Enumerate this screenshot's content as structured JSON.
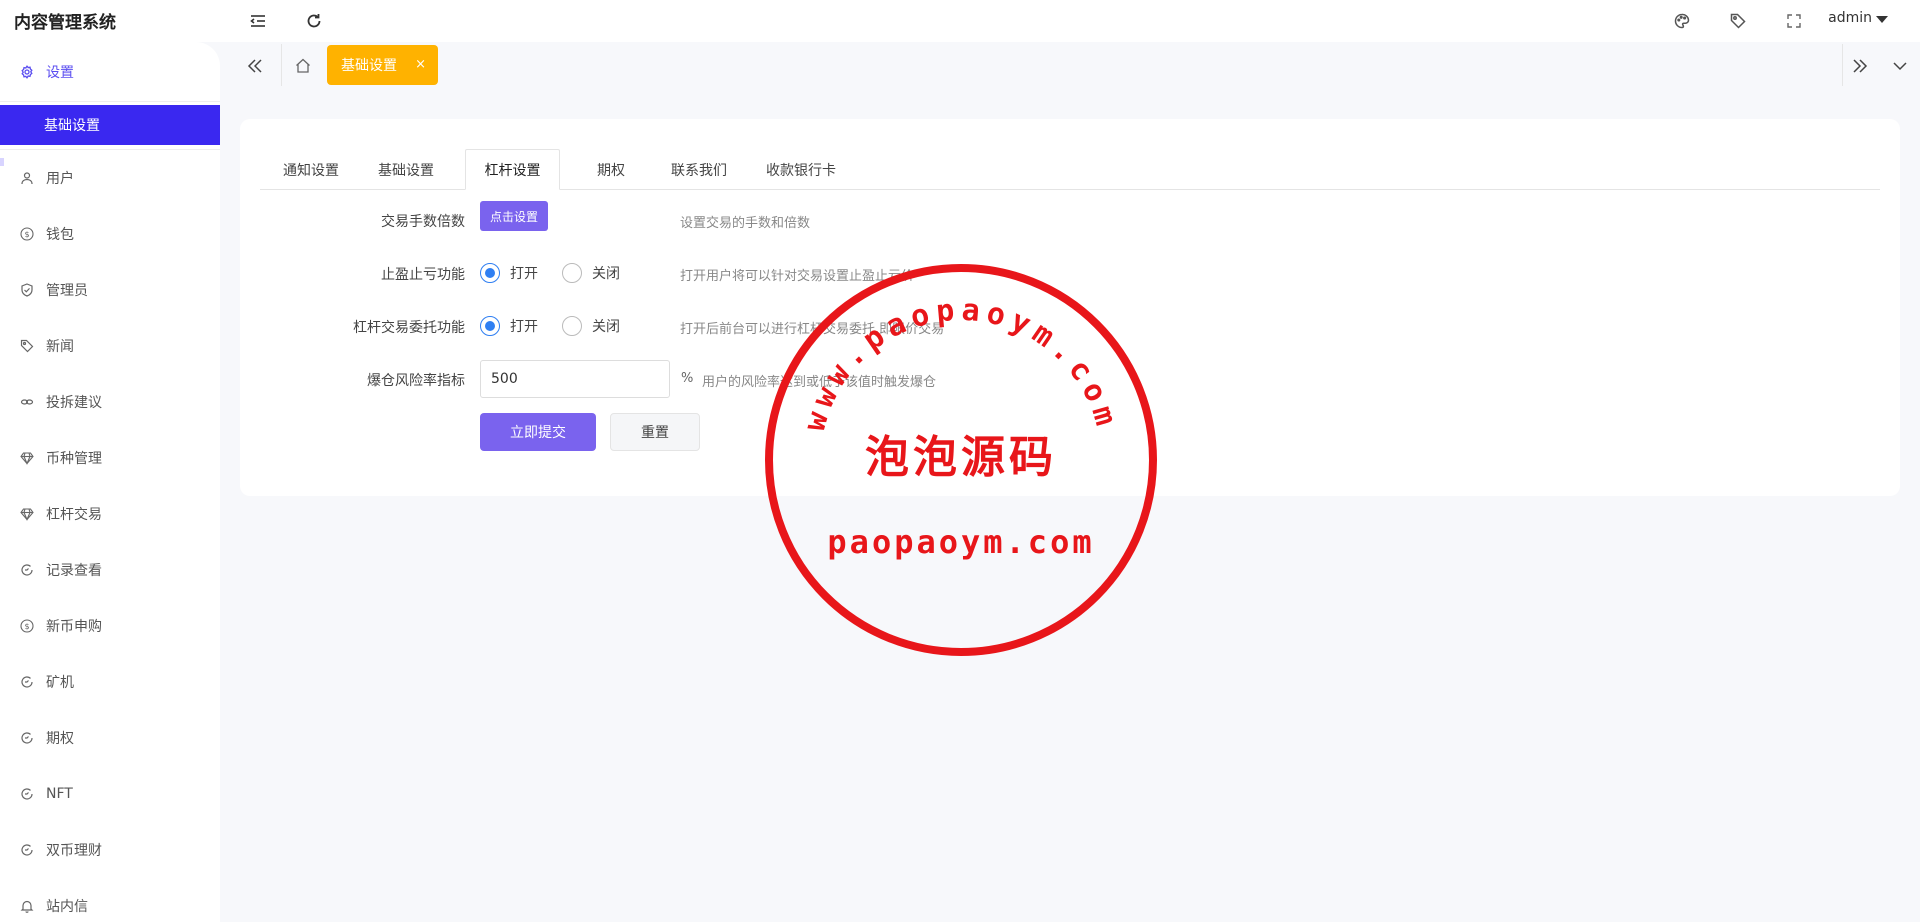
{
  "header": {
    "title": "内容管理系统",
    "user": "admin"
  },
  "sidebar": {
    "section_label": "设置",
    "active_sub": "基础设置",
    "items": [
      {
        "label": "用户",
        "icon": "user-icon"
      },
      {
        "label": "钱包",
        "icon": "dollar-icon"
      },
      {
        "label": "管理员",
        "icon": "shield-check-icon"
      },
      {
        "label": "新闻",
        "icon": "tag-icon"
      },
      {
        "label": "投拆建议",
        "icon": "link-icon"
      },
      {
        "label": "币种管理",
        "icon": "diamond-icon"
      },
      {
        "label": "杠杆交易",
        "icon": "diamond-icon"
      },
      {
        "label": "记录查看",
        "icon": "circle-arrow-icon"
      },
      {
        "label": "新币申购",
        "icon": "dollar-icon"
      },
      {
        "label": "矿机",
        "icon": "circle-arrow-icon"
      },
      {
        "label": "期权",
        "icon": "circle-arrow-icon"
      },
      {
        "label": "NFT",
        "icon": "circle-arrow-icon"
      },
      {
        "label": "双币理财",
        "icon": "circle-arrow-icon"
      },
      {
        "label": "站内信",
        "icon": "bell-icon"
      }
    ]
  },
  "page_tabs": {
    "current": "基础设置",
    "close_symbol": "×"
  },
  "settings": {
    "tabs": [
      {
        "label": "通知设置"
      },
      {
        "label": "基础设置"
      },
      {
        "label": "杠杆设置"
      },
      {
        "label": "期权"
      },
      {
        "label": "联系我们"
      },
      {
        "label": "收款银行卡"
      }
    ],
    "fee_multiplier": {
      "label": "交易手数倍数",
      "button": "点击设置",
      "tip": "设置交易的手数和倍数"
    },
    "stop_profit_loss": {
      "label": "止盈止亏功能",
      "on": "打开",
      "off": "关闭",
      "value": "打开",
      "tip": "打开用户将可以针对交易设置止盈止亏价"
    },
    "leverage_entrust": {
      "label": "杠杆交易委托功能",
      "on": "打开",
      "off": "关闭",
      "value": "打开",
      "tip": "打开后前台可以进行杠杆交易委托,即限价交易"
    },
    "liquidation_risk": {
      "label": "爆仓风险率指标",
      "value": "500",
      "unit": "%",
      "tip": "用户的风险率达到或低于该值时触发爆仓"
    },
    "submit": "立即提交",
    "reset": "重置"
  },
  "watermark": {
    "top_text": "www.paopaoym.com",
    "center_text": "泡泡源码",
    "bottom_text": "paopaoym.com",
    "color": "#e8161a"
  }
}
